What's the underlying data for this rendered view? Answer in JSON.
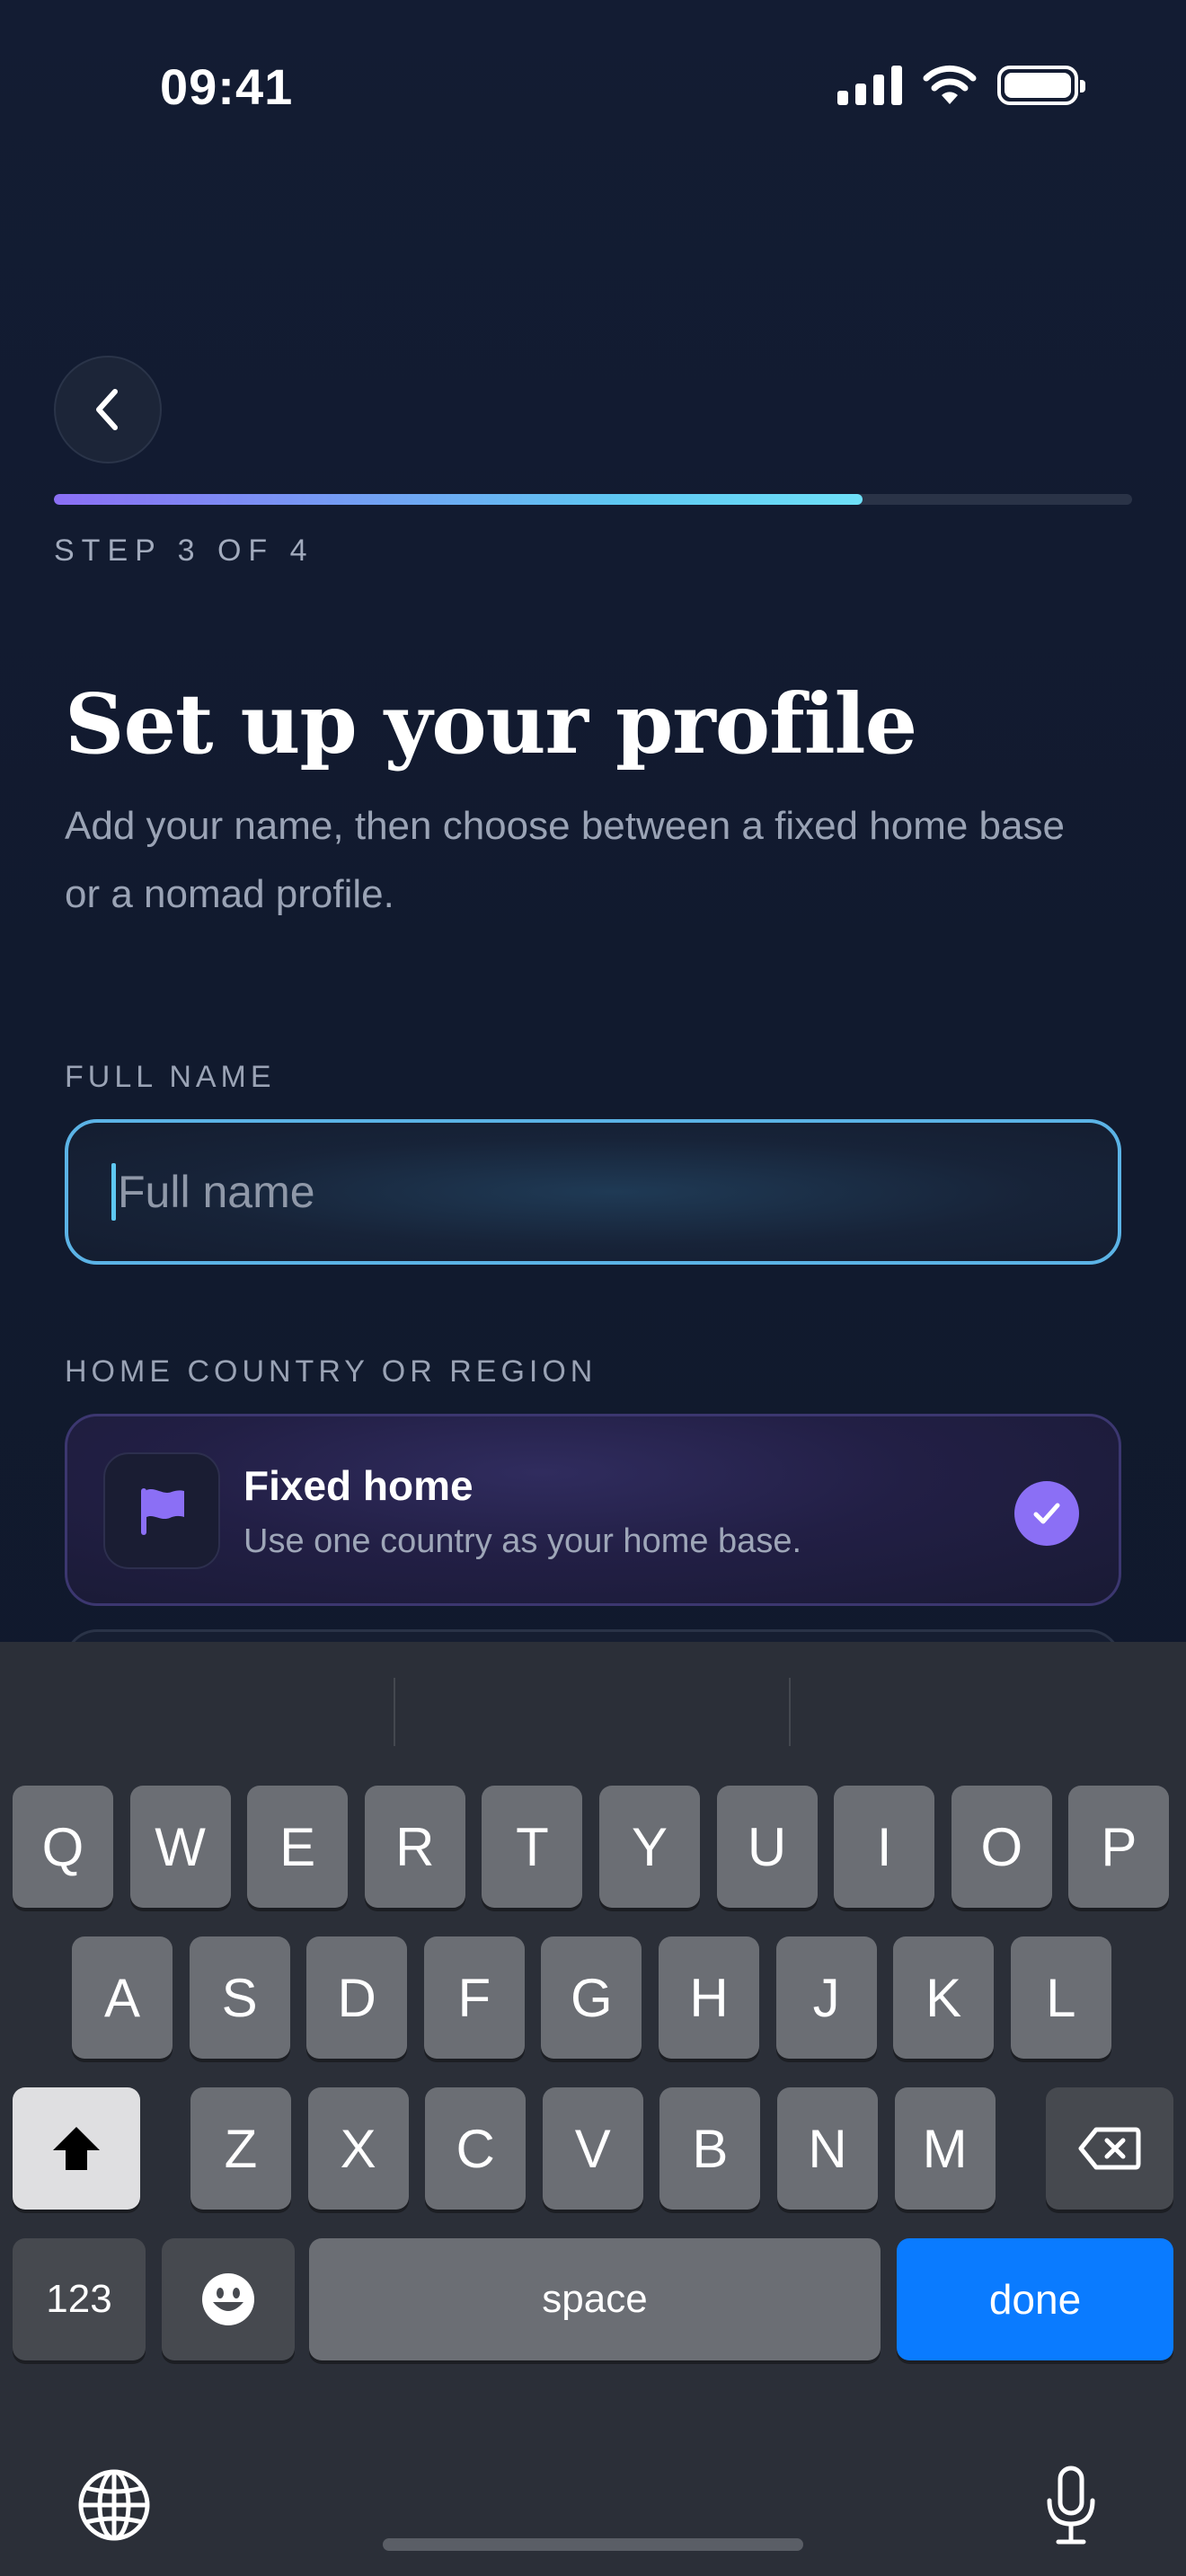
{
  "status_bar": {
    "time": "09:41"
  },
  "header": {
    "step_label": "STEP 3 OF 4",
    "progress_fraction": 0.75
  },
  "content": {
    "title": "Set up your profile",
    "subtitle": "Add your name, then choose between a fixed home base or a nomad profile.",
    "full_name_label": "FULL NAME",
    "full_name_placeholder": "Full name",
    "home_label": "HOME COUNTRY OR REGION",
    "option_fixed": {
      "title": "Fixed home",
      "description": "Use one country as your home base.",
      "selected": true
    }
  },
  "keyboard": {
    "row1": [
      "Q",
      "W",
      "E",
      "R",
      "T",
      "Y",
      "U",
      "I",
      "O",
      "P"
    ],
    "row2": [
      "A",
      "S",
      "D",
      "F",
      "G",
      "H",
      "J",
      "K",
      "L"
    ],
    "row3": [
      "Z",
      "X",
      "C",
      "V",
      "B",
      "N",
      "M"
    ],
    "numbers_key": "123",
    "space_key": "space",
    "done_key": "done"
  },
  "colors": {
    "accent_purple": "#8b6ff5",
    "accent_cyan": "#5ec8f2",
    "done_blue": "#0a7bff"
  }
}
